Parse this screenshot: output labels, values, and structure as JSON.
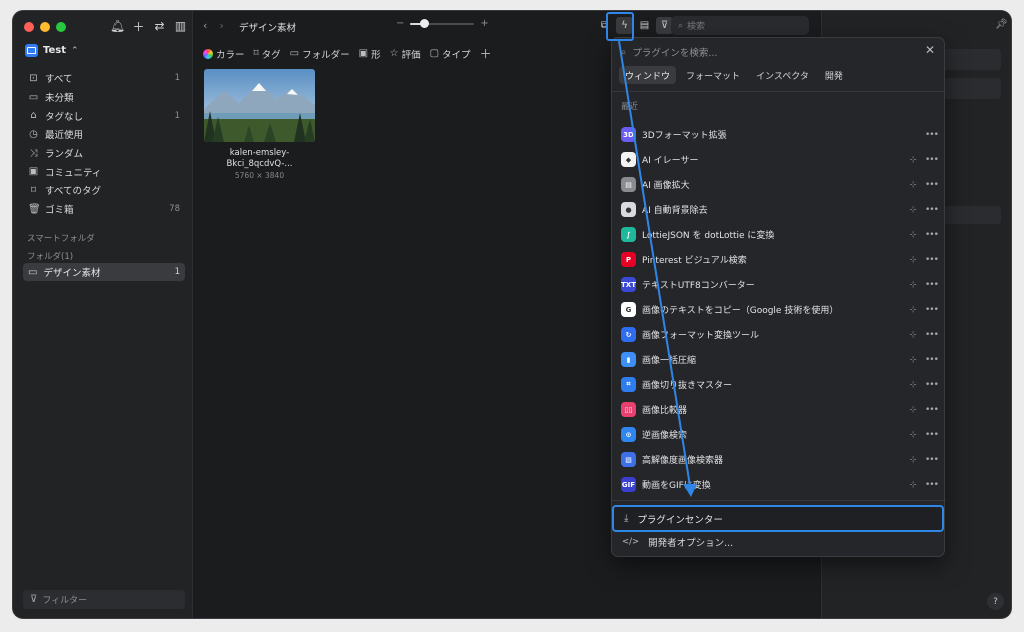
{
  "sidebar": {
    "library_name": "Test",
    "library_chevron": "⌃",
    "items": [
      {
        "icon": "inbox-icon",
        "glyph": "⊡",
        "label": "すべて",
        "count": "1"
      },
      {
        "icon": "folder-unsorted-icon",
        "glyph": "▭",
        "label": "未分類",
        "count": ""
      },
      {
        "icon": "tag-icon",
        "glyph": "⌂",
        "label": "タグなし",
        "count": "1"
      },
      {
        "icon": "clock-icon",
        "glyph": "◷",
        "label": "最近使用",
        "count": ""
      },
      {
        "icon": "shuffle-icon",
        "glyph": "⤨",
        "label": "ランダム",
        "count": ""
      },
      {
        "icon": "community-icon",
        "glyph": "▣",
        "label": "コミュニティ",
        "count": ""
      },
      {
        "icon": "tags-icon",
        "glyph": "⌑",
        "label": "すべてのタグ",
        "count": ""
      },
      {
        "icon": "trash-icon",
        "glyph": "🗑",
        "label": "ゴミ箱",
        "count": "78"
      }
    ],
    "smart_folder_label": "スマートフォルダ",
    "folder_section_label": "フォルダ(1)",
    "folder": {
      "label": "デザイン素材",
      "count": "1"
    },
    "filter_placeholder": "フィルター"
  },
  "toolbar": {
    "breadcrumb": "デザイン素材",
    "zoom_minus": "−",
    "zoom_plus": "+",
    "zoom_level": 0.22,
    "search_placeholder": "検索"
  },
  "filters": [
    {
      "icon": "color-icon",
      "label": "カラー"
    },
    {
      "icon": "bookmark-icon",
      "label": "タグ"
    },
    {
      "icon": "folder-icon",
      "label": "フォルダー"
    },
    {
      "icon": "shape-icon",
      "label": "形"
    },
    {
      "icon": "star-icon",
      "label": "評価"
    },
    {
      "icon": "type-icon",
      "label": "タイプ"
    }
  ],
  "file": {
    "name_line1": "kalen-emsley-",
    "name_line2": "Bkci_8qcdvQ-...",
    "dimensions": "5760 × 3840"
  },
  "plugin_popup": {
    "search_placeholder": "プラグインを検索...",
    "tabs": [
      "ウィンドウ",
      "フォーマット",
      "インスペクタ",
      "開発"
    ],
    "section_label": "最近",
    "plugins": [
      {
        "name": "3Dフォーマット拡張",
        "color": "#6a5cf0",
        "glyph": "3D",
        "pinnable": false
      },
      {
        "name": "AI イレーサー",
        "color": "#f2f2f2",
        "glyph": "◆",
        "pinnable": true
      },
      {
        "name": "AI 画像拡大",
        "color": "#8a8b90",
        "glyph": "▤",
        "pinnable": true
      },
      {
        "name": "AI 自動背景除去",
        "color": "#d8dae0",
        "glyph": "●",
        "pinnable": true
      },
      {
        "name": "LottieJSON を dotLottie に変換",
        "color": "#1fb89a",
        "glyph": "∫",
        "pinnable": true
      },
      {
        "name": "Pinterest ビジュアル検索",
        "color": "#e60023",
        "glyph": "P",
        "pinnable": true
      },
      {
        "name": "テキストUTF8コンバーター",
        "color": "#3b49d6",
        "glyph": "TXT",
        "pinnable": true
      },
      {
        "name": "画像のテキストをコピー（Google 技術を使用）",
        "color": "#ffffff",
        "glyph": "G",
        "pinnable": true
      },
      {
        "name": "画像フォーマット変換ツール",
        "color": "#2f6df0",
        "glyph": "↻",
        "pinnable": true
      },
      {
        "name": "画像一括圧縮",
        "color": "#3d8ff5",
        "glyph": "▮",
        "pinnable": true
      },
      {
        "name": "画像切り抜きマスター",
        "color": "#2d7cf0",
        "glyph": "⌗",
        "pinnable": true
      },
      {
        "name": "画像比較器",
        "color": "#e9416f",
        "glyph": "▯▯",
        "pinnable": true
      },
      {
        "name": "逆画像検索",
        "color": "#2f86f0",
        "glyph": "⊙",
        "pinnable": true
      },
      {
        "name": "高解像度画像検索器",
        "color": "#3e6fe6",
        "glyph": "▨",
        "pinnable": true
      },
      {
        "name": "動画をGIFに変換",
        "color": "#3a3fd0",
        "glyph": "GIF",
        "pinnable": true
      }
    ],
    "plugin_center_label": "プラグインセンター",
    "developer_options_label": "開発者オプション..."
  },
  "inspector": {
    "help_label": "?"
  },
  "colors": {
    "accent": "#2f86e6",
    "window_bg": "#1d1e20",
    "sidebar_bg": "#222325"
  }
}
